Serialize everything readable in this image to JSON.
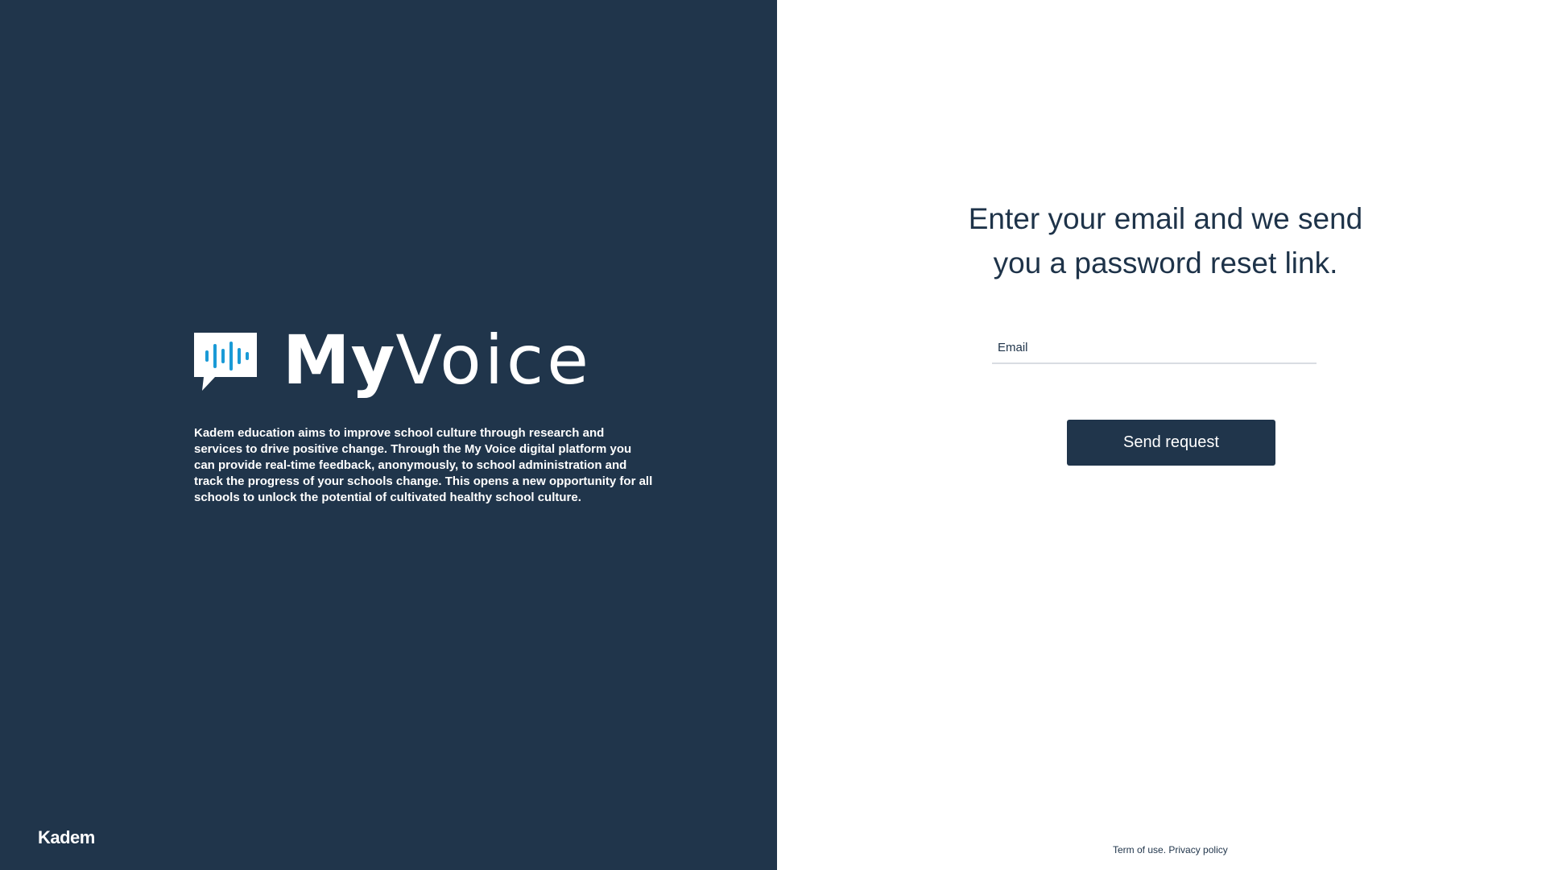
{
  "brand": {
    "logo_my": "My",
    "logo_voice": "Voice",
    "description": "Kadem education aims to improve school culture through research and services to drive positive change.  Through the My Voice digital platform you can provide real-time feedback, anonymously, to school administration and track the progress of your schools change.  This opens a new opportunity for all schools to unlock the potential of cultivated healthy school culture.",
    "company": "Kadem",
    "icon": "speech-bubble-soundwave-icon",
    "colors": {
      "panel_bg": "#20354b",
      "icon_accent": "#1a9ad6"
    }
  },
  "form": {
    "heading": "Enter your email and we send you a password reset link.",
    "email_placeholder": "Email",
    "email_value": "",
    "submit_label": "Send request",
    "colors": {
      "button_bg": "#20354b",
      "text": "#1e3349"
    }
  },
  "footer": {
    "terms_label": "Term of use.",
    "privacy_label": "Privacy policy"
  }
}
